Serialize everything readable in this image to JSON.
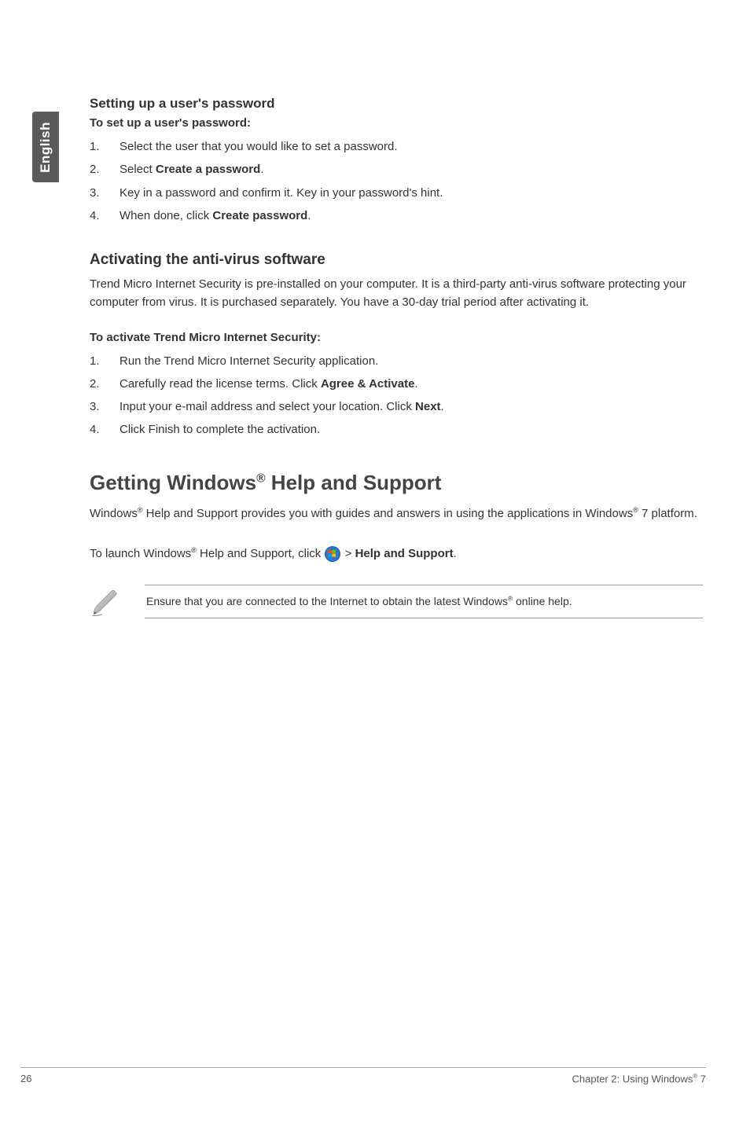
{
  "sideTab": {
    "label": "English"
  },
  "section1": {
    "heading": "Setting up a user's password",
    "subheading": "To set up a user's password:",
    "steps": [
      {
        "num": "1.",
        "text": "Select the user that you would like to set a password."
      },
      {
        "num": "2.",
        "pre": "Select ",
        "bold": "Create a password",
        "post": "."
      },
      {
        "num": "3.",
        "text": "Key in a password and confirm it. Key in your password's hint."
      },
      {
        "num": "4.",
        "pre": "When done, click ",
        "bold": "Create password",
        "post": "."
      }
    ]
  },
  "section2": {
    "heading": "Activating the anti-virus software",
    "intro": "Trend Micro Internet Security is pre-installed on your computer. It is a third-party anti-virus software protecting your computer from virus. It is purchased separately. You have a 30-day trial period after activating it.",
    "subheading": "To activate Trend Micro Internet Security:",
    "steps": [
      {
        "num": "1.",
        "text": "Run the Trend Micro Internet Security application."
      },
      {
        "num": "2.",
        "pre": "Carefully read the license terms. Click ",
        "bold": "Agree & Activate",
        "post": "."
      },
      {
        "num": "3.",
        "pre": "Input your e-mail address and select your location. Click ",
        "bold": "Next",
        "post": "."
      },
      {
        "num": "4.",
        "text": "Click Finish to complete the activation."
      }
    ]
  },
  "section3": {
    "heading_pre": "Getting Windows",
    "heading_sup": "®",
    "heading_post": " Help and Support",
    "body_pre": "Windows",
    "body_sup": "®",
    "body_mid": " Help and Support provides you with guides and answers in using the applications in Windows",
    "body_sup2": "®",
    "body_post": " 7 platform.",
    "launch_pre": "To launch Windows",
    "launch_sup": "®",
    "launch_mid": " Help and Support, click ",
    "launch_after_icon": " > ",
    "launch_bold": "Help and Support",
    "launch_end": ".",
    "note_pre": "Ensure that you are connected to the Internet to obtain the latest Windows",
    "note_sup": "®",
    "note_post": " online help."
  },
  "footer": {
    "page": "26",
    "chapter_pre": "Chapter 2: Using Windows",
    "chapter_sup": "®",
    "chapter_post": " 7"
  }
}
